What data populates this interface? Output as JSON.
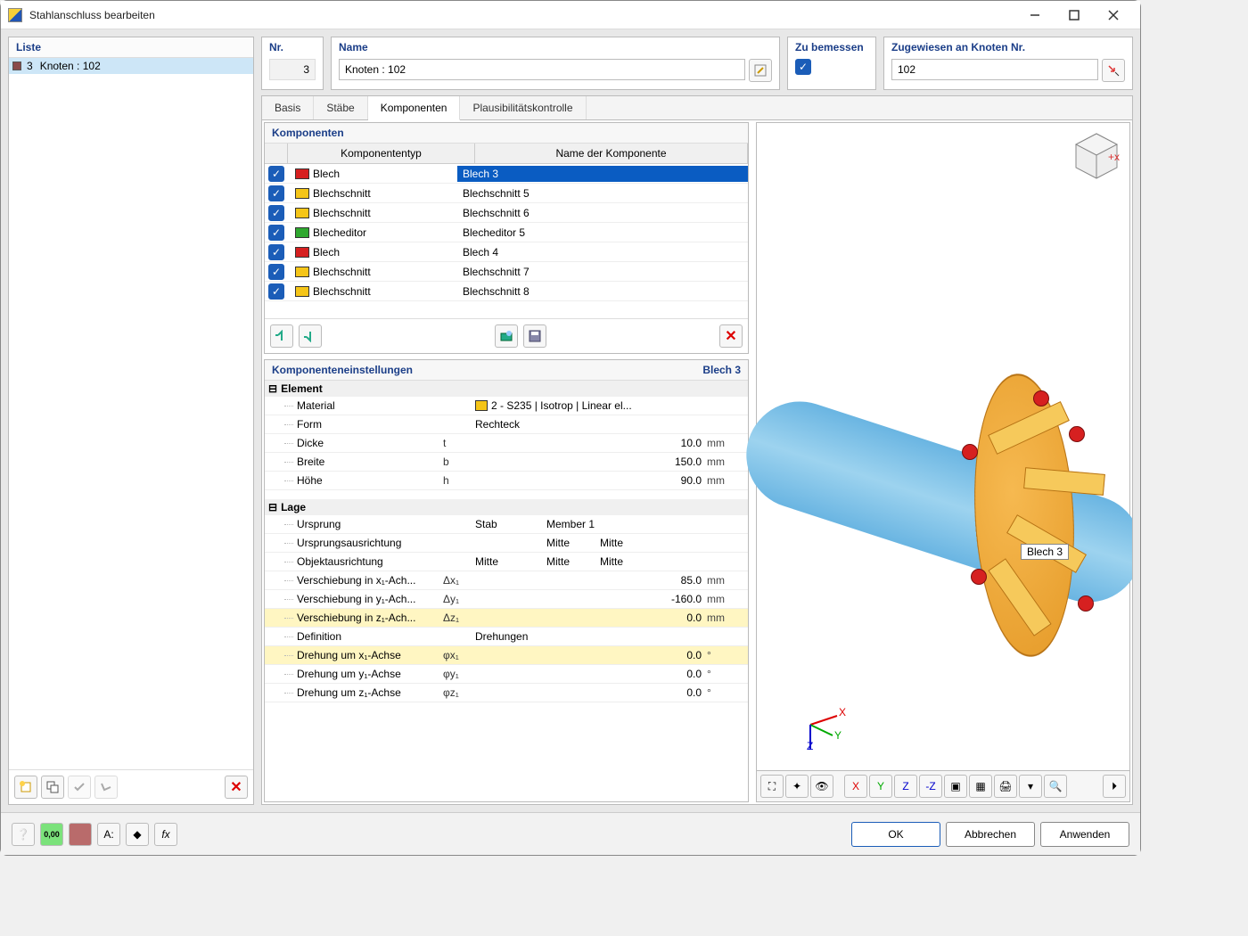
{
  "window": {
    "title": "Stahlanschluss bearbeiten"
  },
  "liste": {
    "header": "Liste",
    "item_num": "3",
    "item_label": "Knoten : 102"
  },
  "header": {
    "nr_label": "Nr.",
    "nr_value": "3",
    "name_label": "Name",
    "name_value": "Knoten : 102",
    "bemessen_label": "Zu bemessen",
    "bemessen_checked": true,
    "assigned_label": "Zugewiesen an Knoten Nr.",
    "assigned_value": "102"
  },
  "tabs": {
    "basis": "Basis",
    "stabe": "Stäbe",
    "komponenten": "Komponenten",
    "plausi": "Plausibilitätskontrolle"
  },
  "komponenten": {
    "title": "Komponenten",
    "col_type": "Komponententyp",
    "col_name": "Name der Komponente",
    "rows": [
      {
        "checked": true,
        "color": "#d62020",
        "type": "Blech",
        "name": "Blech 3",
        "selected": true
      },
      {
        "checked": true,
        "color": "#f5c518",
        "type": "Blechschnitt",
        "name": "Blechschnitt 5",
        "selected": false
      },
      {
        "checked": true,
        "color": "#f5c518",
        "type": "Blechschnitt",
        "name": "Blechschnitt 6",
        "selected": false
      },
      {
        "checked": true,
        "color": "#2fa82f",
        "type": "Blecheditor",
        "name": "Blecheditor 5",
        "selected": false
      },
      {
        "checked": true,
        "color": "#d62020",
        "type": "Blech",
        "name": "Blech 4",
        "selected": false
      },
      {
        "checked": true,
        "color": "#f5c518",
        "type": "Blechschnitt",
        "name": "Blechschnitt 7",
        "selected": false
      },
      {
        "checked": true,
        "color": "#f5c518",
        "type": "Blechschnitt",
        "name": "Blechschnitt 8",
        "selected": false
      }
    ]
  },
  "settings": {
    "title": "Komponenteneinstellungen",
    "title_right": "Blech 3",
    "grp_element": "Element",
    "material_k": "Material",
    "material_v": "2 - S235 | Isotrop | Linear el...",
    "form_k": "Form",
    "form_v": "Rechteck",
    "dicke_k": "Dicke",
    "dicke_s": "t",
    "dicke_v": "10.0",
    "dicke_u": "mm",
    "breite_k": "Breite",
    "breite_s": "b",
    "breite_v": "150.0",
    "breite_u": "mm",
    "hohe_k": "Höhe",
    "hohe_s": "h",
    "hohe_v": "90.0",
    "hohe_u": "mm",
    "grp_lage": "Lage",
    "ursprung_k": "Ursprung",
    "ursprung_v1": "Stab",
    "ursprung_v2": "Member 1",
    "uausr_k": "Ursprungsausrichtung",
    "uausr_v1": "Mitte",
    "uausr_v2": "Mitte",
    "oausr_k": "Objektausrichtung",
    "oausr_v0": "Mitte",
    "oausr_v1": "Mitte",
    "oausr_v2": "Mitte",
    "vx_k": "Verschiebung in x₁-Ach...",
    "vx_s": "Δx₁",
    "vx_v": "85.0",
    "vx_u": "mm",
    "vy_k": "Verschiebung in y₁-Ach...",
    "vy_s": "Δy₁",
    "vy_v": "-160.0",
    "vy_u": "mm",
    "vz_k": "Verschiebung in z₁-Ach...",
    "vz_s": "Δz₁",
    "vz_v": "0.0",
    "vz_u": "mm",
    "def_k": "Definition",
    "def_v": "Drehungen",
    "rx_k": "Drehung um x₁-Achse",
    "rx_s": "φx₁",
    "rx_v": "0.0",
    "rx_u": "°",
    "ry_k": "Drehung um y₁-Achse",
    "ry_s": "φy₁",
    "ry_v": "0.0",
    "ry_u": "°",
    "rz_k": "Drehung um z₁-Achse",
    "rz_s": "φz₁",
    "rz_v": "0.0",
    "rz_u": "°"
  },
  "viewport": {
    "label_tooltip": "Blech 3",
    "axis_x": "X",
    "axis_y": "Y",
    "axis_z": "Z"
  },
  "footer": {
    "ok": "OK",
    "cancel": "Abbrechen",
    "apply": "Anwenden"
  }
}
